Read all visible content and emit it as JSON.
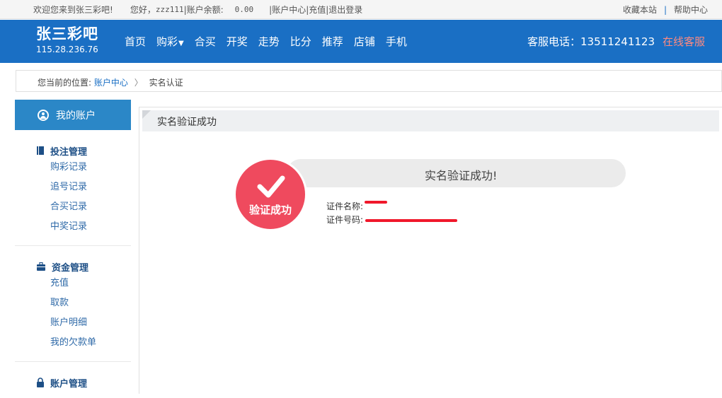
{
  "topbar": {
    "welcome": "欢迎您来到张三彩吧!",
    "greeting": "您好，",
    "username": "zzz111",
    "balance_label": "|账户余额:",
    "balance_value": "0.00",
    "links": [
      "|账户中心",
      "|充值",
      "|退出登录"
    ],
    "bookmark": "收藏本站",
    "help": "帮助中心"
  },
  "header": {
    "site_name": "张三彩吧",
    "ip": "115.28.236.76",
    "nav": [
      "首页",
      "购彩",
      "合买",
      "开奖",
      "走势",
      "比分",
      "推荐",
      "店铺",
      "手机"
    ],
    "hotline_label": "客服电话：",
    "hotline_number": "13511241123",
    "online_service": "在线客服"
  },
  "breadcrumb": {
    "prefix": "您当前的位置:",
    "account_center": "账户中心",
    "current": "实名认证"
  },
  "sidebar": {
    "my_account": "我的账户",
    "groups": [
      {
        "title": "投注管理",
        "icon": "book-icon",
        "items": [
          "购彩记录",
          "追号记录",
          "合买记录",
          "中奖记录"
        ]
      },
      {
        "title": "资金管理",
        "icon": "briefcase-icon",
        "items": [
          "充值",
          "取款",
          "账户明细",
          "我的欠款单"
        ]
      },
      {
        "title": "账户管理",
        "icon": "lock-icon",
        "items": []
      }
    ]
  },
  "panel": {
    "title": "实名验证成功",
    "result_text": "实名验证成功!",
    "badge_text": "验证成功",
    "id_name_label": "证件名称:",
    "id_number_label": "证件号码:"
  },
  "colors": {
    "header_bg": "#1a6fc4",
    "sidebar_active": "#2b87c7",
    "badge": "#ef4a5e",
    "redaction": "#f0182b",
    "online_service": "#ff8a80"
  }
}
